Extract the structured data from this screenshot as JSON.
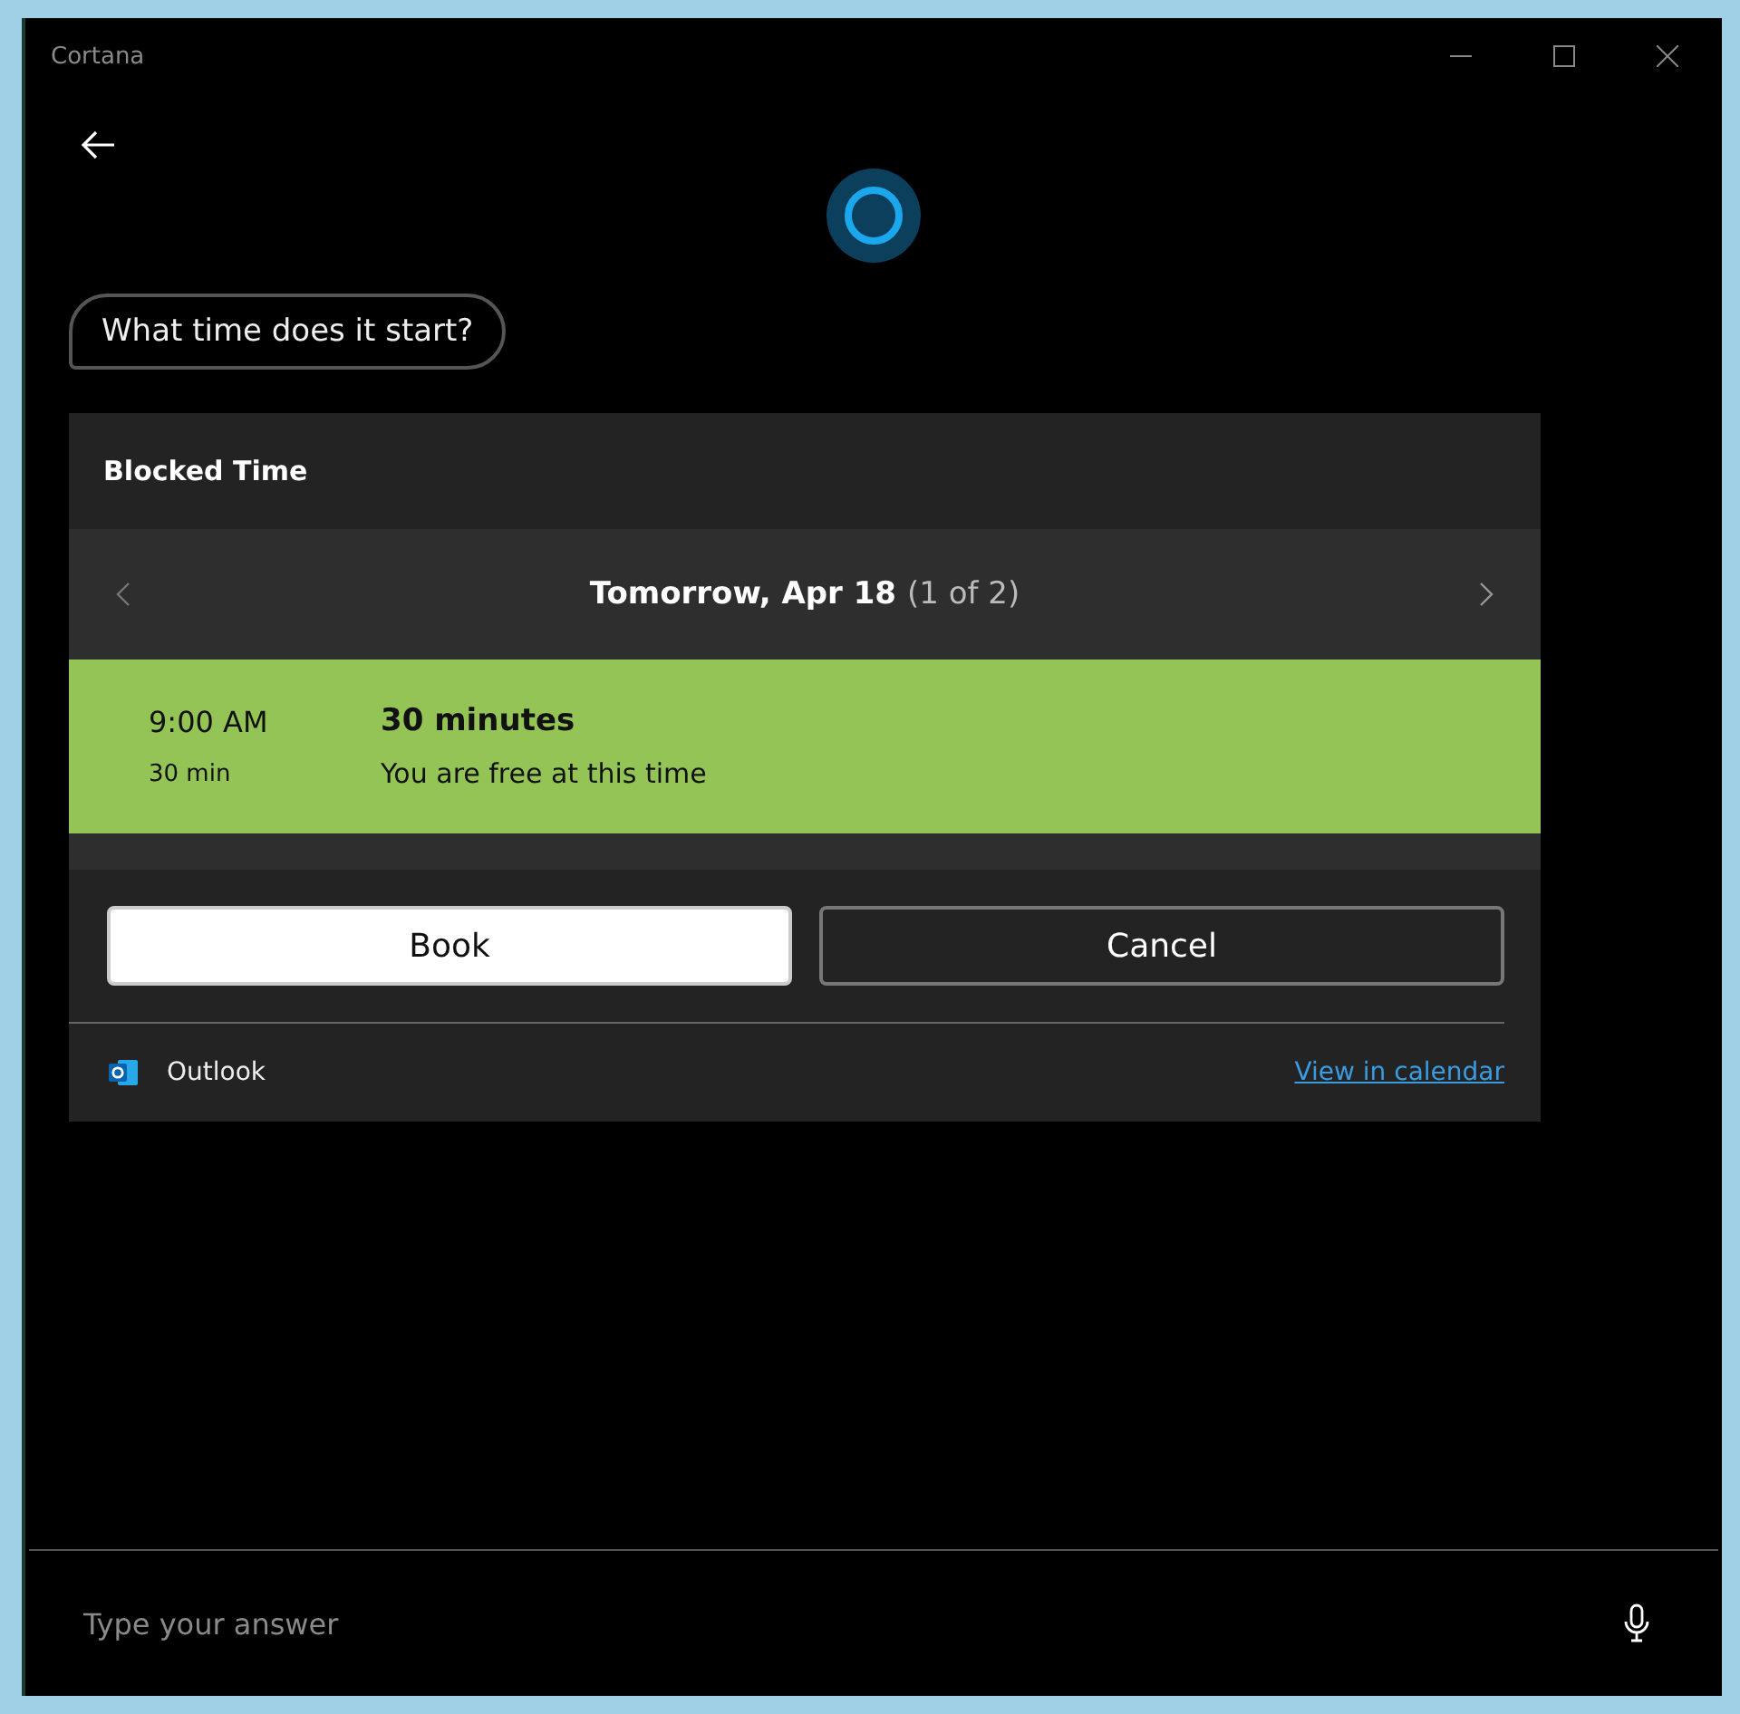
{
  "window": {
    "title": "Cortana"
  },
  "query": "What time does it start?",
  "card": {
    "title": "Blocked Time",
    "date": "Tomorrow, Apr 18",
    "counter": "(1 of 2)",
    "slot": {
      "time": "9:00 AM",
      "length": "30 min",
      "title": "30 minutes",
      "status": "You are free at this time"
    },
    "buttons": [
      {
        "label": "Book",
        "kind": "primary"
      },
      {
        "label": "Cancel",
        "kind": "secondary"
      }
    ],
    "source": "Outlook",
    "link": "View in calendar"
  },
  "answer": {
    "placeholder": "Type your answer"
  }
}
